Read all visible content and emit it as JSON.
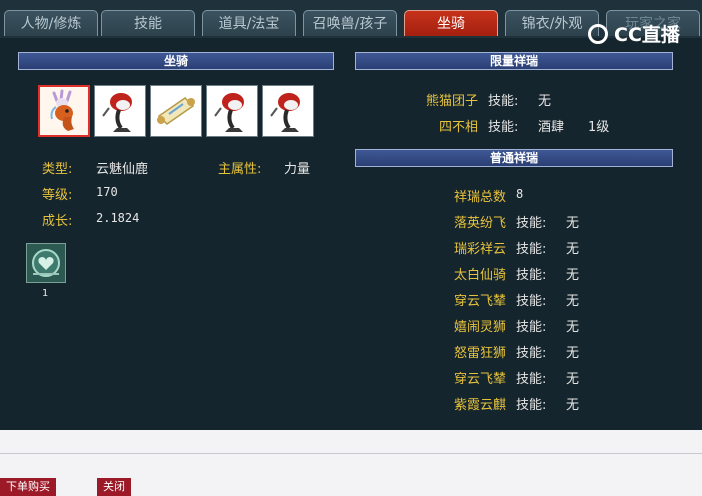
{
  "tabs": [
    {
      "label": "人物/修炼"
    },
    {
      "label": "技能"
    },
    {
      "label": "道具/法宝"
    },
    {
      "label": "召唤兽/孩子"
    },
    {
      "label": "坐骑",
      "active": true
    },
    {
      "label": "锦衣/外观"
    },
    {
      "label": "玩家之家"
    }
  ],
  "logo": {
    "text": "CC直播"
  },
  "mount": {
    "section_title": "坐骑",
    "slots": [
      {
        "icon": "deer-mount-icon",
        "selected": true
      },
      {
        "icon": "crane-mount-icon"
      },
      {
        "icon": "scroll-icon"
      },
      {
        "icon": "crane-mount-icon"
      },
      {
        "icon": "crane-mount-icon"
      }
    ],
    "type_label": "类型:",
    "type_value": "云魅仙鹿",
    "main_attr_label": "主属性:",
    "main_attr_value": "力量",
    "level_label": "等级:",
    "level_value": "170",
    "growth_label": "成长:",
    "growth_value": "2.1824",
    "skill_icon": "heart-emblem-icon",
    "skill_count": "1"
  },
  "limited": {
    "section_title": "限量祥瑞",
    "items": [
      {
        "name": "熊猫团子",
        "skill_label": "技能:",
        "skill_value": "无",
        "extra": ""
      },
      {
        "name": "四不相",
        "skill_label": "技能:",
        "skill_value": "酒肆",
        "extra": "1级"
      }
    ]
  },
  "normal": {
    "section_title": "普通祥瑞",
    "total_label": "祥瑞总数",
    "total_value": "8",
    "items": [
      {
        "name": "落英纷飞",
        "skill_label": "技能:",
        "skill_value": "无"
      },
      {
        "name": "瑞彩祥云",
        "skill_label": "技能:",
        "skill_value": "无"
      },
      {
        "name": "太白仙骑",
        "skill_label": "技能:",
        "skill_value": "无"
      },
      {
        "name": "穿云飞辇",
        "skill_label": "技能:",
        "skill_value": "无"
      },
      {
        "name": "嬉闹灵狮",
        "skill_label": "技能:",
        "skill_value": "无"
      },
      {
        "name": "怒雷狂狮",
        "skill_label": "技能:",
        "skill_value": "无"
      },
      {
        "name": "穿云飞辇",
        "skill_label": "技能:",
        "skill_value": "无"
      },
      {
        "name": "紫霞云麒",
        "skill_label": "技能:",
        "skill_value": "无"
      }
    ]
  },
  "footer": {
    "order_button": "下单购买",
    "close_button": "关闭"
  },
  "colors": {
    "panel_bg": "#15252d",
    "label_gold": "#e6c23d",
    "active_tab": "#c7321b",
    "section_blue": "#2a3f74",
    "button_red": "#9c1a28"
  }
}
